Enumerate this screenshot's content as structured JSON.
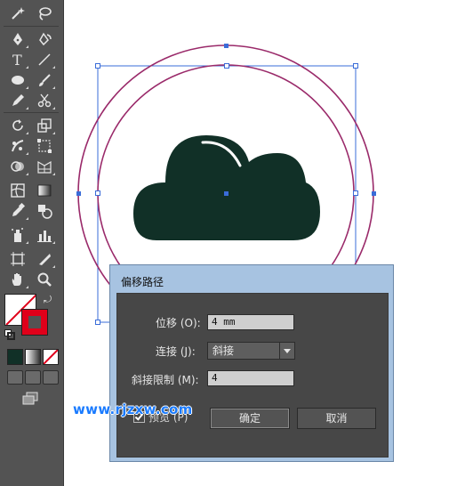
{
  "dialog": {
    "title": "偏移路径",
    "offset_label": "位移 (O):",
    "offset_value": "4 mm",
    "joins_label": "连接 (J):",
    "joins_value": "斜接",
    "miter_label": "斜接限制 (M):",
    "miter_value": "4",
    "preview_label": "预览 (P)",
    "preview_checked": true,
    "ok_label": "确定",
    "cancel_label": "取消"
  },
  "watermark": "www.rjzxw.com",
  "colors": {
    "cloud_fill": "#113027",
    "ring_stroke": "#9a2a6a",
    "selection": "#3a6cd8",
    "fill_swatch": "#ffffff",
    "stroke_swatch": "#e0001a",
    "toolbar_bg": "#535353",
    "dialog_frame": "#a7c3e1",
    "dialog_body": "#474747"
  },
  "toolbar": {
    "tools": [
      "magic-wand-icon",
      "lasso-icon",
      "pen-icon",
      "curvature-icon",
      "type-icon",
      "line-segment-icon",
      "ellipse-icon",
      "paintbrush-icon",
      "pencil-icon",
      "scissors-icon",
      "rotate-icon",
      "scale-icon",
      "puppet-warp-icon",
      "free-transform-icon",
      "shape-builder-icon",
      "perspective-grid-icon",
      "mesh-icon",
      "gradient-icon",
      "eyedropper-icon",
      "blend-icon",
      "symbol-sprayer-icon",
      "column-graph-icon",
      "artboard-icon",
      "slice-icon",
      "hand-icon",
      "zoom-icon"
    ]
  }
}
